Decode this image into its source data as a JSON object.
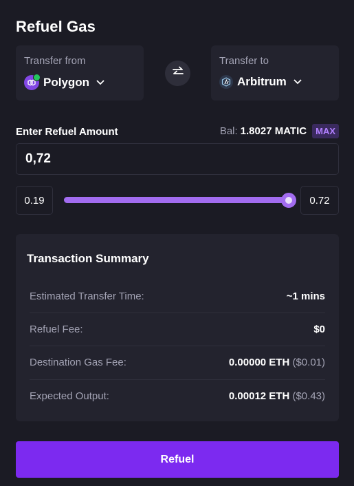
{
  "title": "Refuel Gas",
  "from": {
    "label": "Transfer from",
    "chain": "Polygon",
    "icon": "polygon-icon"
  },
  "to": {
    "label": "Transfer to",
    "chain": "Arbitrum",
    "icon": "arbitrum-icon"
  },
  "amount": {
    "label": "Enter Refuel Amount",
    "balance_prefix": "Bal:",
    "balance_value": "1.8027 MATIC",
    "max_label": "MAX",
    "value": "0,72"
  },
  "slider": {
    "min": "0.19",
    "max": "0.72",
    "fraction": 1.0
  },
  "summary": {
    "title": "Transaction Summary",
    "rows": [
      {
        "key": "Estimated Transfer Time:",
        "value": "~1 mins",
        "usd": ""
      },
      {
        "key": "Refuel Fee:",
        "value": "$0",
        "usd": ""
      },
      {
        "key": "Destination Gas Fee:",
        "value": "0.00000 ETH",
        "usd": "($0.01)"
      },
      {
        "key": "Expected Output:",
        "value": "0.00012 ETH",
        "usd": "($0.43)"
      }
    ]
  },
  "submit_label": "Refuel",
  "colors": {
    "accent": "#7c2af0",
    "slider": "#a26cf0",
    "background": "#1b1b24",
    "panel": "#23232e"
  }
}
